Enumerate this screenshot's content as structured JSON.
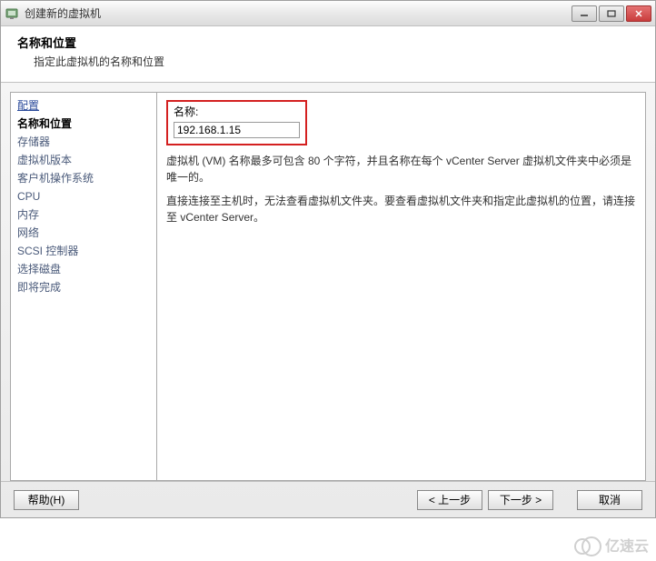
{
  "titlebar": {
    "title": "创建新的虚拟机"
  },
  "header": {
    "title": "名称和位置",
    "subtitle": "指定此虚拟机的名称和位置"
  },
  "sidebar": {
    "items": [
      {
        "label": "配置",
        "type": "link"
      },
      {
        "label": "名称和位置",
        "type": "current"
      },
      {
        "label": "存储器",
        "type": "disabled"
      },
      {
        "label": "虚拟机版本",
        "type": "disabled"
      },
      {
        "label": "客户机操作系统",
        "type": "disabled"
      },
      {
        "label": "CPU",
        "type": "disabled"
      },
      {
        "label": "内存",
        "type": "disabled"
      },
      {
        "label": "网络",
        "type": "disabled"
      },
      {
        "label": "SCSI 控制器",
        "type": "disabled"
      },
      {
        "label": "选择磁盘",
        "type": "disabled"
      },
      {
        "label": "即将完成",
        "type": "disabled"
      }
    ]
  },
  "main": {
    "name_label": "名称:",
    "name_value": "192.168.1.15",
    "info1": "虚拟机 (VM) 名称最多可包含 80 个字符，并且名称在每个 vCenter Server 虚拟机文件夹中必须是唯一的。",
    "info2": "直接连接至主机时，无法查看虚拟机文件夹。要查看虚拟机文件夹和指定此虚拟机的位置，请连接至 vCenter Server。"
  },
  "footer": {
    "help": "帮助(H)",
    "back": "< 上一步",
    "next": "下一步 >",
    "cancel": "取消"
  },
  "watermark": "亿速云"
}
